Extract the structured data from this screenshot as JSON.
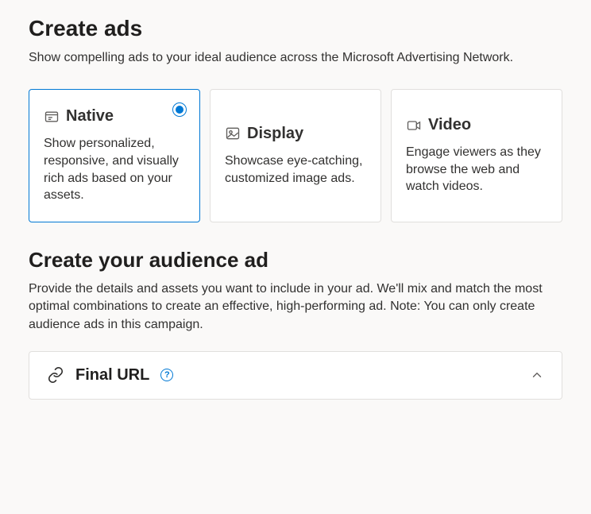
{
  "header": {
    "title": "Create ads",
    "intro": "Show compelling ads to your ideal audience across the Microsoft Advertising Network."
  },
  "adTypes": [
    {
      "id": "native",
      "title": "Native",
      "desc": "Show personalized, responsive, and visually rich ads based on your assets.",
      "selected": true
    },
    {
      "id": "display",
      "title": "Display",
      "desc": "Showcase eye-catching, customized image ads.",
      "selected": false
    },
    {
      "id": "video",
      "title": "Video",
      "desc": "Engage viewers as they browse the web and watch videos.",
      "selected": false
    }
  ],
  "audienceSection": {
    "title": "Create your audience ad",
    "desc": "Provide the details and assets you want to include in your ad. We'll mix and match the most optimal combinations to create an effective, high-performing ad. Note: You can only create audience ads in this campaign."
  },
  "finalUrlPanel": {
    "label": "Final URL",
    "expanded": true
  }
}
